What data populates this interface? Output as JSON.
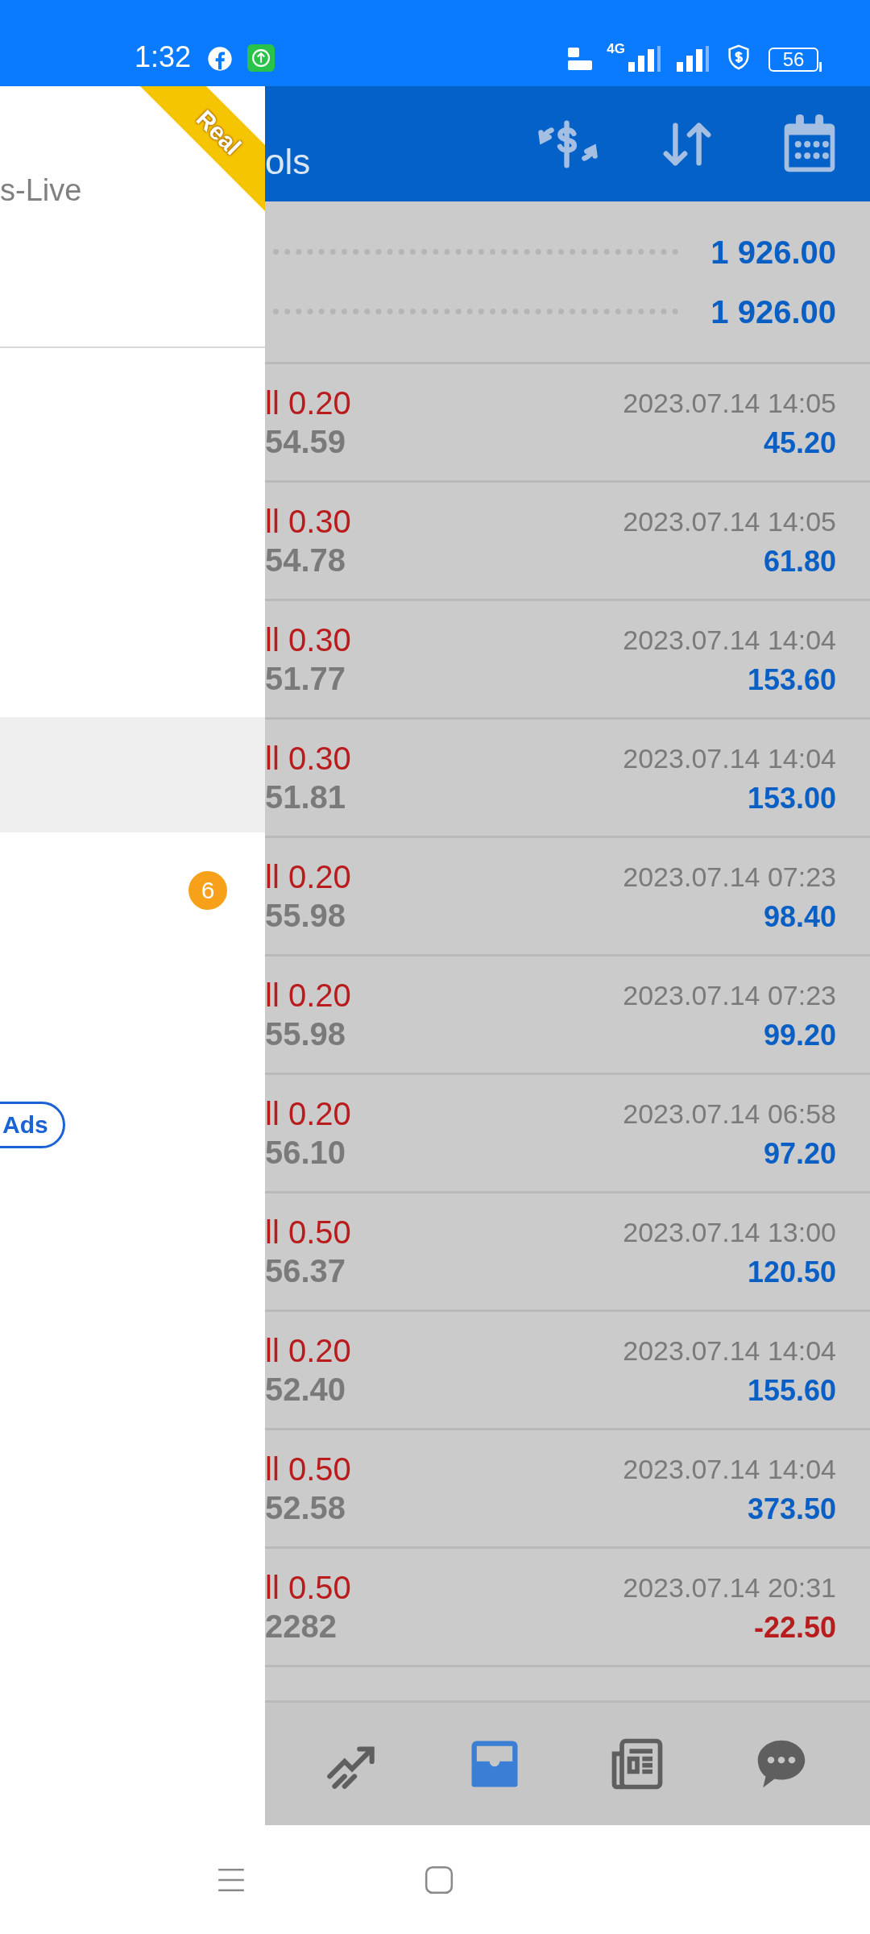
{
  "status_bar": {
    "time": "1:32",
    "network": "4G",
    "battery": "56"
  },
  "drawer": {
    "account": "s-Live",
    "ribbon": "Real",
    "menu_items": [
      {
        "selected": true
      },
      {
        "selected": false,
        "badge": "6"
      }
    ],
    "ads_button": "Ads"
  },
  "toolbar": {
    "title": "ols"
  },
  "balances": [
    {
      "value": "1 926.00"
    },
    {
      "value": "1 926.00"
    }
  ],
  "trades": [
    {
      "kind": "profit",
      "order": "ll 0.20",
      "price": "54.59",
      "time": "2023.07.14 14:05",
      "profit": "45.20"
    },
    {
      "kind": "profit",
      "order": "ll 0.30",
      "price": "54.78",
      "time": "2023.07.14 14:05",
      "profit": "61.80"
    },
    {
      "kind": "profit",
      "order": "ll 0.30",
      "price": "51.77",
      "time": "2023.07.14 14:04",
      "profit": "153.60"
    },
    {
      "kind": "profit",
      "order": "ll 0.30",
      "price": "51.81",
      "time": "2023.07.14 14:04",
      "profit": "153.00"
    },
    {
      "kind": "profit",
      "order": "ll 0.20",
      "price": "55.98",
      "time": "2023.07.14 07:23",
      "profit": "98.40"
    },
    {
      "kind": "profit",
      "order": "ll 0.20",
      "price": "55.98",
      "time": "2023.07.14 07:23",
      "profit": "99.20"
    },
    {
      "kind": "profit",
      "order": "ll 0.20",
      "price": "56.10",
      "time": "2023.07.14 06:58",
      "profit": "97.20"
    },
    {
      "kind": "profit",
      "order": "ll 0.50",
      "price": "56.37",
      "time": "2023.07.14 13:00",
      "profit": "120.50"
    },
    {
      "kind": "profit",
      "order": "ll 0.20",
      "price": "52.40",
      "time": "2023.07.14 14:04",
      "profit": "155.60"
    },
    {
      "kind": "profit",
      "order": "ll 0.50",
      "price": "52.58",
      "time": "2023.07.14 14:04",
      "profit": "373.50"
    },
    {
      "kind": "loss",
      "order": "ll 0.50",
      "price": "2282",
      "time": "2023.07.14 20:31",
      "profit": "-22.50"
    }
  ],
  "bottom_nav": [
    {
      "selected": false
    },
    {
      "selected": true
    },
    {
      "selected": false
    },
    {
      "selected": false
    }
  ]
}
